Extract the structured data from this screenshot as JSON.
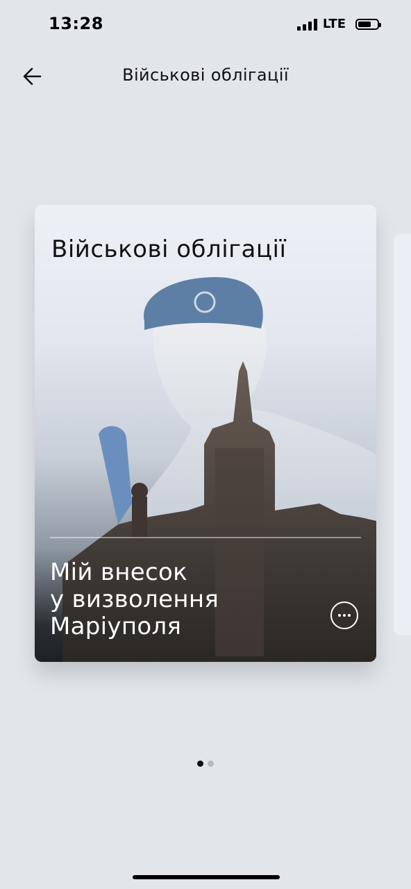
{
  "status_bar": {
    "time": "13:28",
    "network": "LTE",
    "battery_level": 0.6
  },
  "header": {
    "title": "Військові облігації",
    "back_icon": "arrow-left-icon"
  },
  "card": {
    "title": "Військові облігації",
    "subtitle_lines": [
      "Мій внесок",
      "у визволення",
      "Маріуполя"
    ],
    "more_icon": "more-horizontal-icon"
  },
  "pager": {
    "total": 2,
    "current": 1
  }
}
